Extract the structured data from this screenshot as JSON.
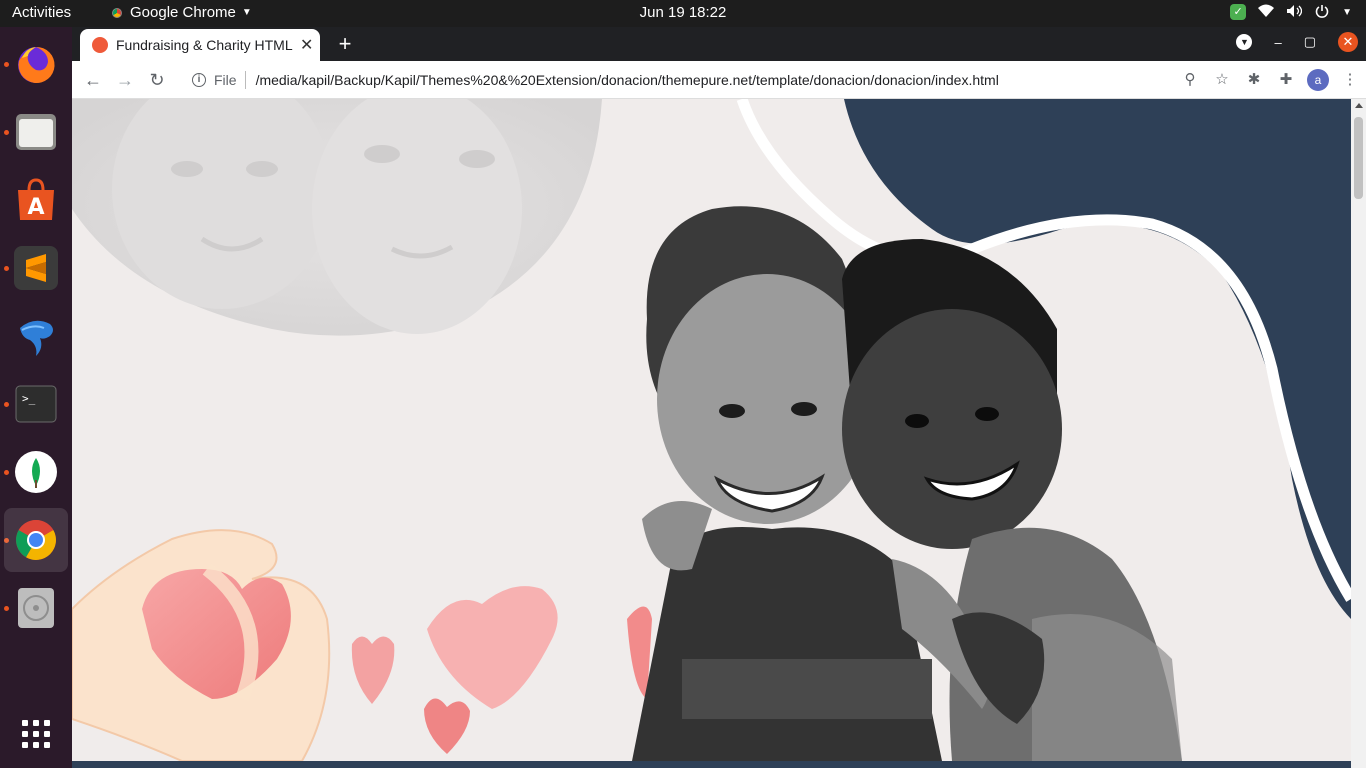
{
  "topbar": {
    "activities": "Activities",
    "app_name": "Google Chrome",
    "clock": "Jun 19  18:22"
  },
  "dock": {
    "items": [
      {
        "name": "firefox",
        "running": true
      },
      {
        "name": "files",
        "running": true
      },
      {
        "name": "ubuntu-software",
        "running": false
      },
      {
        "name": "sublime-text",
        "running": true
      },
      {
        "name": "mysql-workbench",
        "running": false
      },
      {
        "name": "terminal",
        "running": true
      },
      {
        "name": "mongodb-compass",
        "running": true
      },
      {
        "name": "google-chrome",
        "running": true,
        "active": true
      },
      {
        "name": "disk",
        "running": true
      }
    ]
  },
  "browser": {
    "tab_title": "Fundraising & Charity HTML",
    "new_tab": "+",
    "omnibox": {
      "scheme": "File",
      "url": "/media/kapil/Backup/Kapil/Themes%20&%20Extension/donacion/themepure.net/template/donacion/donacion/index.html"
    },
    "profile_initial": "a"
  },
  "colors": {
    "page_bg": "#f0eceb",
    "navy_blob": "#2e4057",
    "heart_pink": "#f28b8b"
  }
}
